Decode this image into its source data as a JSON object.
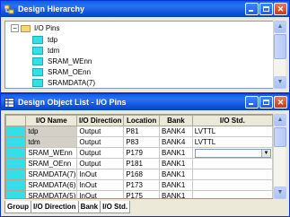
{
  "hierarchy": {
    "title": "Design Hierarchy",
    "root_label": "I/O Pins",
    "items": [
      "tdp",
      "tdm",
      "SRAM_WEnn",
      "SRAM_OEnn",
      "SRAMDATA(7)"
    ]
  },
  "objlist": {
    "title": "Design Object List - I/O Pins",
    "columns": [
      "I/O Name",
      "I/O Direction",
      "Location",
      "Bank",
      "I/O Std."
    ],
    "rows": [
      {
        "name": "tdp",
        "dir": "Output",
        "loc": "P81",
        "bank": "BANK4",
        "std": "LVTTL"
      },
      {
        "name": "tdm",
        "dir": "Output",
        "loc": "P83",
        "bank": "BANK4",
        "std": "LVTTL"
      },
      {
        "name": "SRAM_WEnn",
        "dir": "Output",
        "loc": "P179",
        "bank": "BANK1",
        "std": ""
      },
      {
        "name": "SRAM_OEnn",
        "dir": "Output",
        "loc": "P181",
        "bank": "BANK1",
        "std": ""
      },
      {
        "name": "SRAMDATA(7)",
        "dir": "InOut",
        "loc": "P168",
        "bank": "BANK1",
        "std": ""
      },
      {
        "name": "SRAMDATA(6)",
        "dir": "InOut",
        "loc": "P173",
        "bank": "BANK1",
        "std": ""
      },
      {
        "name": "SRAMDATA(5)",
        "dir": "InOut",
        "loc": "P175",
        "bank": "BANK1",
        "std": ""
      }
    ],
    "tabs": [
      "Group",
      "I/O Direction",
      "Bank",
      "I/O Std."
    ]
  }
}
